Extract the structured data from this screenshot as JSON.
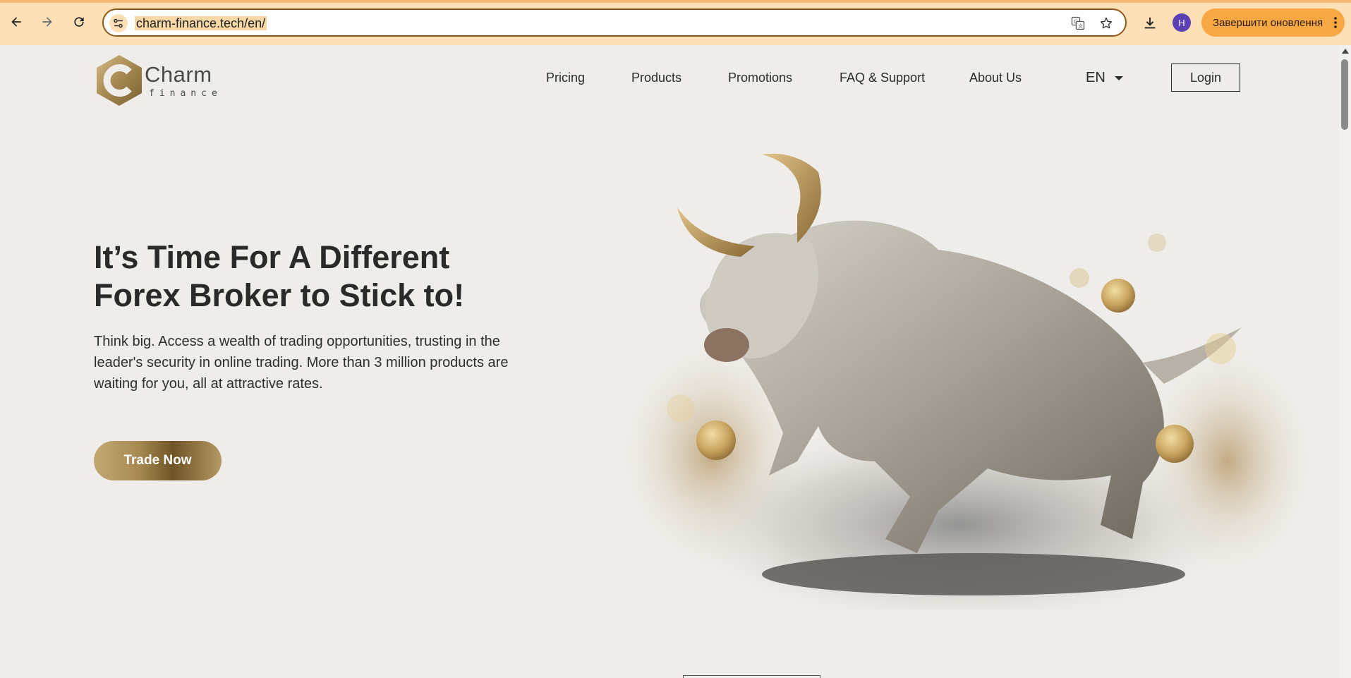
{
  "browser": {
    "url": "charm-finance.tech/en/",
    "profile_initial": "H",
    "update_label": "Завершити оновлення",
    "icons": {
      "back": "arrow-left-icon",
      "forward": "arrow-right-icon",
      "reload": "reload-icon",
      "site_settings": "tune-icon",
      "translate": "translate-icon",
      "bookmark": "star-icon",
      "download": "download-icon",
      "menu": "kebab-menu-icon"
    },
    "colors": {
      "toolbar": "#fde0b8",
      "update_button": "#f7a843",
      "avatar": "#5b3fb3"
    }
  },
  "site": {
    "logo": {
      "word": "Charm",
      "sub": "finance"
    },
    "nav": [
      {
        "label": "Pricing"
      },
      {
        "label": "Products"
      },
      {
        "label": "Promotions"
      },
      {
        "label": "FAQ & Support"
      },
      {
        "label": "About Us"
      }
    ],
    "language": "EN",
    "login_label": "Login",
    "hero": {
      "title_line1": "It’s Time For A Different",
      "title_line2": "Forex Broker to Stick to!",
      "text_line1": "Think big. Access a wealth of trading opportunities, trusting in the",
      "text_line2": "leader's security in online trading. More than 3 million products are",
      "text_line3": "waiting for you, all at attractive rates.",
      "cta_label": "Trade Now",
      "image": "charging-bull-with-gold-coins"
    },
    "colors": {
      "background": "#efede9",
      "gold": "#b49965",
      "text": "#2a2a2a"
    }
  }
}
